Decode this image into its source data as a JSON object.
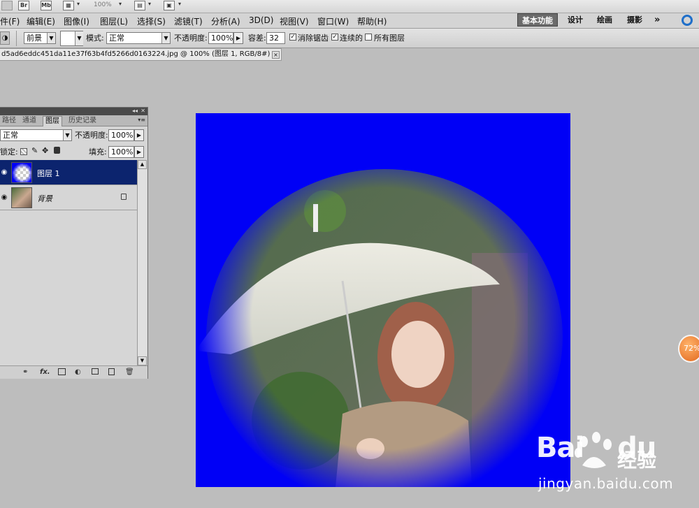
{
  "topbar": {
    "br": "Br",
    "mb": "Mb",
    "zoom": "100%"
  },
  "menu": {
    "items": [
      "件(F)",
      "编辑(E)",
      "图像(I)",
      "图层(L)",
      "选择(S)",
      "滤镜(T)",
      "分析(A)",
      "3D(D)",
      "视图(V)",
      "窗口(W)",
      "帮助(H)"
    ],
    "workspaces": [
      "基本功能",
      "设计",
      "绘画",
      "摄影"
    ],
    "more": "»"
  },
  "options": {
    "source": "前景",
    "mode_label": "模式:",
    "mode": "正常",
    "opacity_label": "不透明度:",
    "opacity": "100%",
    "tolerance_label": "容差:",
    "tolerance": "32",
    "antialias": "消除锯齿",
    "contiguous": "连续的",
    "all_layers": "所有图层"
  },
  "doc": {
    "tab": "d5ad6eddc451da11e37f63b4fd5266d0163224.jpg @ 100% (图层 1, RGB/8#) *",
    "close": "×"
  },
  "layers_panel": {
    "tabs": [
      "路径",
      "通道",
      "图层",
      "历史记录"
    ],
    "blend": "正常",
    "opacity_label": "不透明度:",
    "opacity": "100%",
    "lock_label": "锁定:",
    "fill_label": "填充:",
    "fill": "100%",
    "layers": [
      {
        "name": "图层 1",
        "selected": true
      },
      {
        "name": "背景",
        "selected": false
      }
    ],
    "bottom_icons": [
      "link-icon",
      "fx-icon",
      "mask-icon",
      "adjust-icon",
      "group-icon",
      "new-layer-icon",
      "trash-icon"
    ],
    "fx": "fx."
  },
  "canvas": {
    "background_color": "#0000f6"
  },
  "float_badge": "72%",
  "watermark": {
    "logo": "Bai",
    "logo2": "du",
    "cn": "经验",
    "url": "jingyan.baidu.com"
  }
}
